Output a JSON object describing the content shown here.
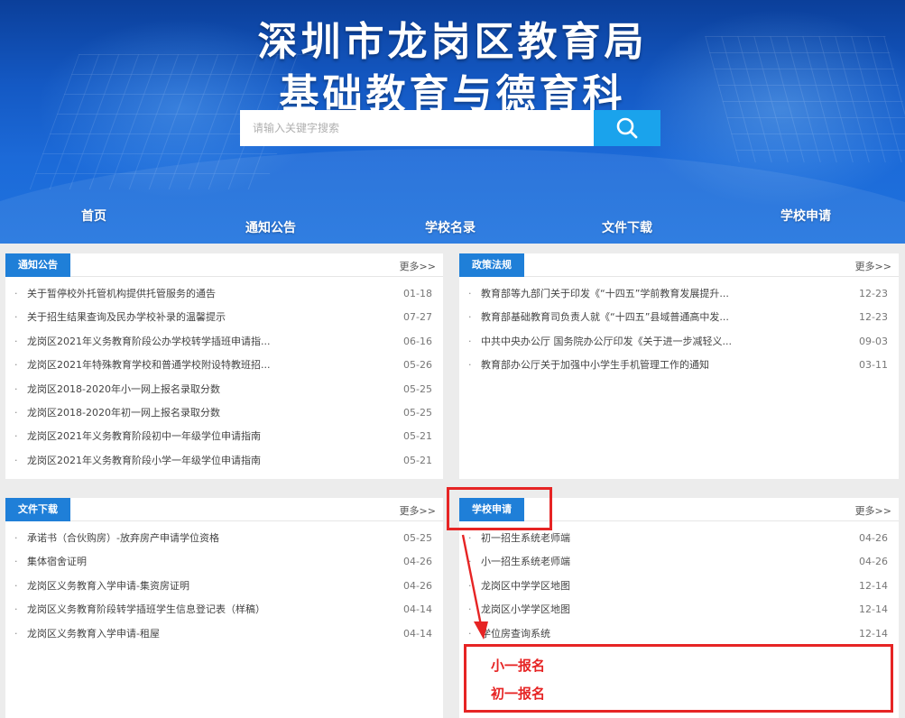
{
  "banner": {
    "title_line1": "深圳市龙岗区教育局",
    "title_line2": "基础教育与德育科",
    "search": {
      "placeholder": "请输入关键字搜索",
      "icon": "search-icon"
    }
  },
  "nav": {
    "items": [
      "首页",
      "通知公告",
      "学校名录",
      "文件下载",
      "学校申请"
    ]
  },
  "panels": {
    "notices": {
      "tab": "通知公告",
      "more": "更多>>",
      "items": [
        {
          "title": "关于暂停校外托管机构提供托管服务的通告",
          "date": "01-18"
        },
        {
          "title": "关于招生结果查询及民办学校补录的温馨提示",
          "date": "07-27"
        },
        {
          "title": "龙岗区2021年义务教育阶段公办学校转学插班申请指...",
          "date": "06-16"
        },
        {
          "title": "龙岗区2021年特殊教育学校和普通学校附设特教班招...",
          "date": "05-26"
        },
        {
          "title": "龙岗区2018-2020年小一网上报名录取分数",
          "date": "05-25"
        },
        {
          "title": "龙岗区2018-2020年初一网上报名录取分数",
          "date": "05-25"
        },
        {
          "title": "龙岗区2021年义务教育阶段初中一年级学位申请指南",
          "date": "05-21"
        },
        {
          "title": "龙岗区2021年义务教育阶段小学一年级学位申请指南",
          "date": "05-21"
        }
      ]
    },
    "policies": {
      "tab": "政策法规",
      "more": "更多>>",
      "items": [
        {
          "title": "教育部等九部门关于印发《“十四五”学前教育发展提升...",
          "date": "12-23"
        },
        {
          "title": "教育部基础教育司负责人就《“十四五”县域普通高中发...",
          "date": "12-23"
        },
        {
          "title": "中共中央办公厅 国务院办公厅印发《关于进一步减轻义...",
          "date": "09-03"
        },
        {
          "title": "教育部办公厅关于加强中小学生手机管理工作的通知",
          "date": "03-11"
        }
      ]
    },
    "downloads": {
      "tab": "文件下载",
      "more": "更多>>",
      "items": [
        {
          "title": "承诺书（合伙购房）-放弃房产申请学位资格",
          "date": "05-25"
        },
        {
          "title": "集体宿舍证明",
          "date": "04-26"
        },
        {
          "title": "龙岗区义务教育入学申请-集资房证明",
          "date": "04-26"
        },
        {
          "title": "龙岗区义务教育阶段转学插班学生信息登记表（样稿）",
          "date": "04-14"
        },
        {
          "title": "龙岗区义务教育入学申请-租屋",
          "date": "04-14"
        }
      ]
    },
    "applications": {
      "tab": "学校申请",
      "more": "更多>>",
      "items": [
        {
          "title": "初一招生系统老师端",
          "date": "04-26"
        },
        {
          "title": "小一招生系统老师端",
          "date": "04-26"
        },
        {
          "title": "龙岗区中学学区地图",
          "date": "12-14"
        },
        {
          "title": "龙岗区小学学区地图",
          "date": "12-14"
        },
        {
          "title": "学位房查询系统",
          "date": "12-14"
        }
      ]
    }
  },
  "annotations": {
    "label1": "小一报名",
    "label2": "初一报名",
    "color": "#e62424"
  },
  "colors": {
    "accent": "#1f7fd8",
    "search_button": "#1aa3ec"
  }
}
